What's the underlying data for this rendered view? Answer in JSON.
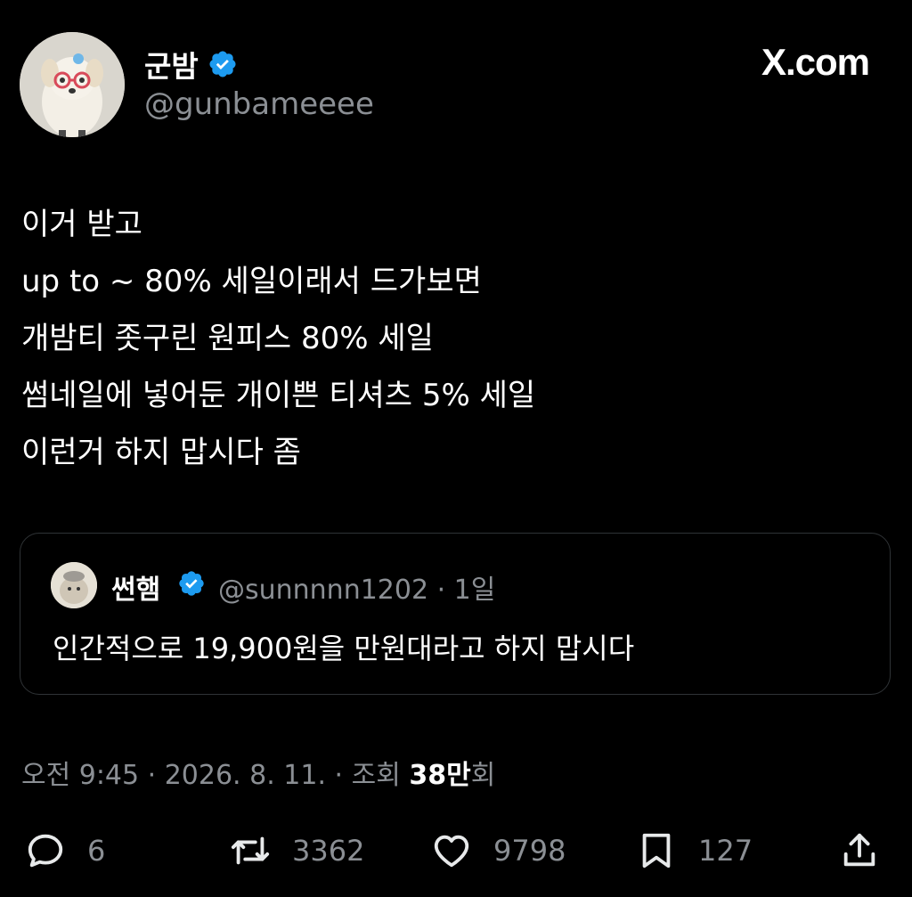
{
  "author": {
    "display_name": "군밤",
    "handle": "@gunbameeee",
    "verified": true,
    "avatar_icon": "dog-with-glasses-avatar"
  },
  "brand": {
    "logo_text": "X.com"
  },
  "tweet": {
    "lines": [
      "이거 받고",
      "up to ~ 80% 세일이래서 드가보면",
      "개밤티 좃구린 원피스 80% 세일",
      "썸네일에 넣어둔 개이쁜 티셔츠 5% 세일",
      "이런거 하지 맙시다 좀"
    ]
  },
  "quote": {
    "display_name": "썬햄",
    "meta": "@sunnnnn1202 · 1일",
    "text": "인간적으로 19,900원을 만원대라고 하지 맙시다",
    "avatar_icon": "hamster-avatar"
  },
  "meta": {
    "prefix": "오전 9:45 · 2026. 8. 11. · 조회 ",
    "views_bold": "38만",
    "views_suffix": "회"
  },
  "actions": {
    "reply_count": "6",
    "retweet_count": "3362",
    "like_count": "9798",
    "bookmark_count": "127"
  },
  "colors": {
    "verified": "#1d9bf0",
    "muted": "#8b8f94",
    "border": "#2f3336"
  }
}
